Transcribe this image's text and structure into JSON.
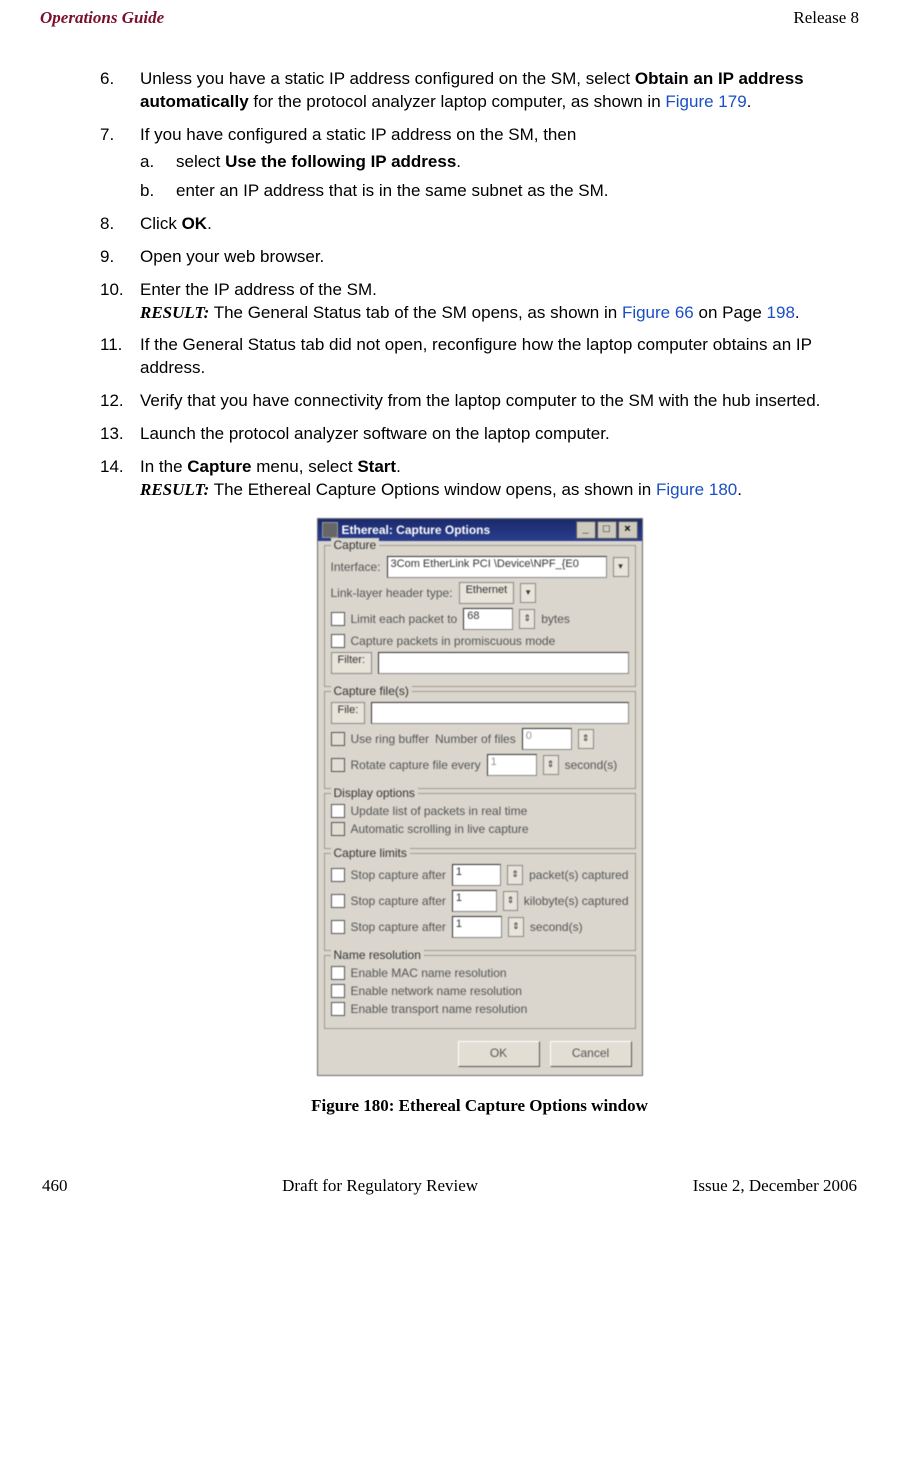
{
  "header": {
    "left": "Operations Guide",
    "right": "Release 8"
  },
  "steps": {
    "s6": {
      "num": "6.",
      "t1": "Unless you have a static IP address configured on the SM, select ",
      "bold": "Obtain an IP address automatically",
      "t2": " for the protocol analyzer laptop computer, as shown in ",
      "link": "Figure 179",
      "t3": "."
    },
    "s7": {
      "num": "7.",
      "text": "If you have configured a static IP address on the SM, then",
      "a": {
        "num": "a.",
        "t1": "select ",
        "bold": "Use the following IP address",
        "t2": "."
      },
      "b": {
        "num": "b.",
        "text": "enter an IP address that is in the same subnet as the SM."
      }
    },
    "s8": {
      "num": "8.",
      "t1": "Click ",
      "bold": "OK",
      "t2": "."
    },
    "s9": {
      "num": "9.",
      "text": "Open your web browser."
    },
    "s10": {
      "num": "10.",
      "line1": "Enter the IP address of the SM.",
      "result_label": "RESULT:",
      "r1": " The General Status tab of the SM opens, as shown in ",
      "link1": "Figure 66",
      "r2": " on Page ",
      "link2": "198",
      "r3": "."
    },
    "s11": {
      "num": "11.",
      "text": "If the General Status tab did not open, reconfigure how the laptop computer obtains an IP address."
    },
    "s12": {
      "num": "12.",
      "text": "Verify that you have connectivity from the laptop computer to the SM with the hub inserted."
    },
    "s13": {
      "num": "13.",
      "text": "Launch the protocol analyzer software on the laptop computer."
    },
    "s14": {
      "num": "14.",
      "t1": "In the ",
      "b1": "Capture",
      "t2": " menu, select ",
      "b2": "Start",
      "t3": ".",
      "result_label": "RESULT:",
      "r1": " The Ethereal Capture Options window opens, as shown in ",
      "link": "Figure 180",
      "r2": "."
    }
  },
  "ethereal": {
    "title": "Ethereal: Capture Options",
    "capture": {
      "legend": "Capture",
      "interface_label": "Interface:",
      "interface_value": "3Com EtherLink PCI  \\Device\\NPF_{E0",
      "link_layer_label": "Link-layer header type:",
      "link_layer_value": "Ethernet",
      "limit_label": "Limit each packet to",
      "limit_value": "68",
      "limit_unit": "bytes",
      "promisc": "Capture packets in promiscuous mode",
      "filter_btn": "Filter:"
    },
    "files": {
      "legend": "Capture file(s)",
      "file_btn": "File:",
      "ring_label": "Use ring buffer",
      "ring_files_label": "Number of files",
      "ring_files_value": "0",
      "rotate_label": "Rotate capture file every",
      "rotate_value": "1",
      "rotate_unit": "second(s)"
    },
    "display": {
      "legend": "Display options",
      "update": "Update list of packets in real time",
      "autoscroll": "Automatic scrolling in live capture"
    },
    "limits": {
      "legend": "Capture limits",
      "after1": "Stop capture after",
      "v1": "1",
      "u1": "packet(s) captured",
      "after2": "Stop capture after",
      "v2": "1",
      "u2": "kilobyte(s) captured",
      "after3": "Stop capture after",
      "v3": "1",
      "u3": "second(s)"
    },
    "name_res": {
      "legend": "Name resolution",
      "mac": "Enable MAC name resolution",
      "net": "Enable network name resolution",
      "trans": "Enable transport name resolution"
    },
    "ok": "OK",
    "cancel": "Cancel"
  },
  "figure_caption": "Figure 180: Ethereal Capture Options window",
  "footer": {
    "left": "460",
    "center": "Draft for Regulatory Review",
    "right": "Issue 2, December 2006"
  }
}
